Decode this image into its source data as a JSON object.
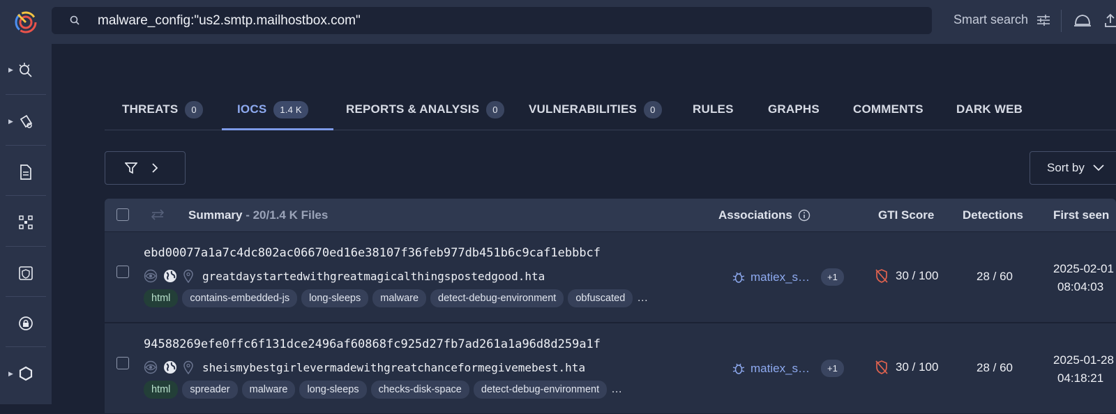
{
  "search": {
    "query": "malware_config:\"us2.smtp.mailhostbox.com\""
  },
  "topbar": {
    "smart_search_label": "Smart search"
  },
  "tabs": [
    {
      "label": "THREATS",
      "badge": "0"
    },
    {
      "label": "IOCS",
      "badge": "1.4 K"
    },
    {
      "label": "REPORTS & ANALYSIS",
      "badge": "0"
    },
    {
      "label": "VULNERABILITIES",
      "badge": "0"
    },
    {
      "label": "RULES"
    },
    {
      "label": "GRAPHS"
    },
    {
      "label": "COMMENTS"
    },
    {
      "label": "DARK WEB"
    }
  ],
  "toolbar": {
    "sort_label": "Sort by"
  },
  "table": {
    "summary_label": "Summary",
    "summary_count": "- 20/1.4 K Files",
    "col_associations": "Associations",
    "col_gti": "GTI Score",
    "col_detections": "Detections",
    "col_first_seen": "First seen"
  },
  "rows": [
    {
      "hash": "ebd00077a1a7c4dc802ac06670ed16e38107f36feb977db451b6c9caf1ebbbcf",
      "filename": "greatdaystartedwithgreatmagicalthingspostedgood.hta",
      "tags": [
        "html",
        "contains-embedded-js",
        "long-sleeps",
        "malware",
        "detect-debug-environment",
        "obfuscated"
      ],
      "more": "…",
      "association": "matiex_s…",
      "association_more": "+1",
      "gti": "30 / 100",
      "detections": "28 / 60",
      "first_seen_date": "2025-02-01",
      "first_seen_time": "08:04:03"
    },
    {
      "hash": "94588269efe0ffc6f131dce2496af60868fc925d27fb7ad261a1a96d8d259a1f",
      "filename": "sheismybestgirlevermadewithgreatchanceformegivemebest.hta",
      "tags": [
        "html",
        "spreader",
        "malware",
        "long-sleeps",
        "checks-disk-space",
        "detect-debug-environment"
      ],
      "more": "…",
      "association": "matiex_s…",
      "association_more": "+1",
      "gti": "30 / 100",
      "detections": "28 / 60",
      "first_seen_date": "2025-01-28",
      "first_seen_time": "04:18:21"
    }
  ],
  "colors": {
    "accent": "#8eaaf0",
    "danger": "#e0624f",
    "bg": "#1b2234",
    "bar": "#2a3349"
  },
  "icons": {
    "sidebar": [
      "threat-hunt-icon",
      "intel-icon",
      "report-icon",
      "graph-icon",
      "shield-icon",
      "lock-icon",
      "hexagon-icon"
    ]
  }
}
